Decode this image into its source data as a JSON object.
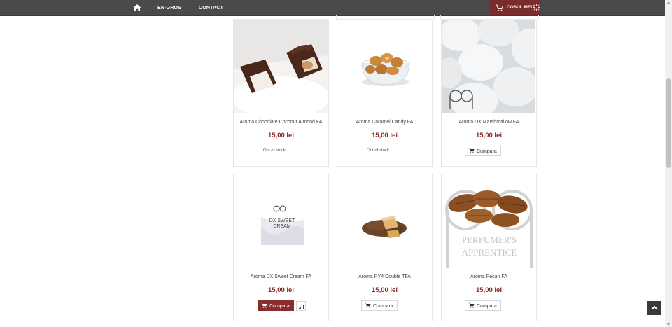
{
  "nav": {
    "home_icon": "home-icon",
    "links": [
      "EN-GROS",
      "CONTACT"
    ],
    "cart_label": "COSUL MEU",
    "cart_icon": "cart-icon",
    "cart_spinner_icon": "spinner-icon"
  },
  "colors": {
    "accent": "#8b2c2c",
    "topbar": "#4a4a4a",
    "cart_bg": "#7b2d2d"
  },
  "products": [
    {
      "name": "Aroma Chocolate Coconut Almond FA",
      "price": "15,00 lei",
      "status": "Out of stock"
    },
    {
      "name": "Aroma Caramel Candy FA",
      "price": "15,00 lei",
      "status": "Out of stock"
    },
    {
      "name": "Aroma DX Marshmallow FA",
      "price": "15,00 lei",
      "button": "Cumpara"
    },
    {
      "name": "Aroma DX Sweet Cream FA",
      "price": "15,00 lei",
      "button": "Cumpara",
      "image_text": [
        "DX SWEET",
        "CREAM"
      ]
    },
    {
      "name": "Aroma RY4 Double TFA",
      "price": "15,00 lei",
      "button": "Cumpara"
    },
    {
      "name": "Aroma Pecan FA",
      "price": "15,00 lei",
      "button": "Cumpara",
      "image_text": [
        "PERFUMER'S",
        "APPRENTICE"
      ]
    }
  ]
}
